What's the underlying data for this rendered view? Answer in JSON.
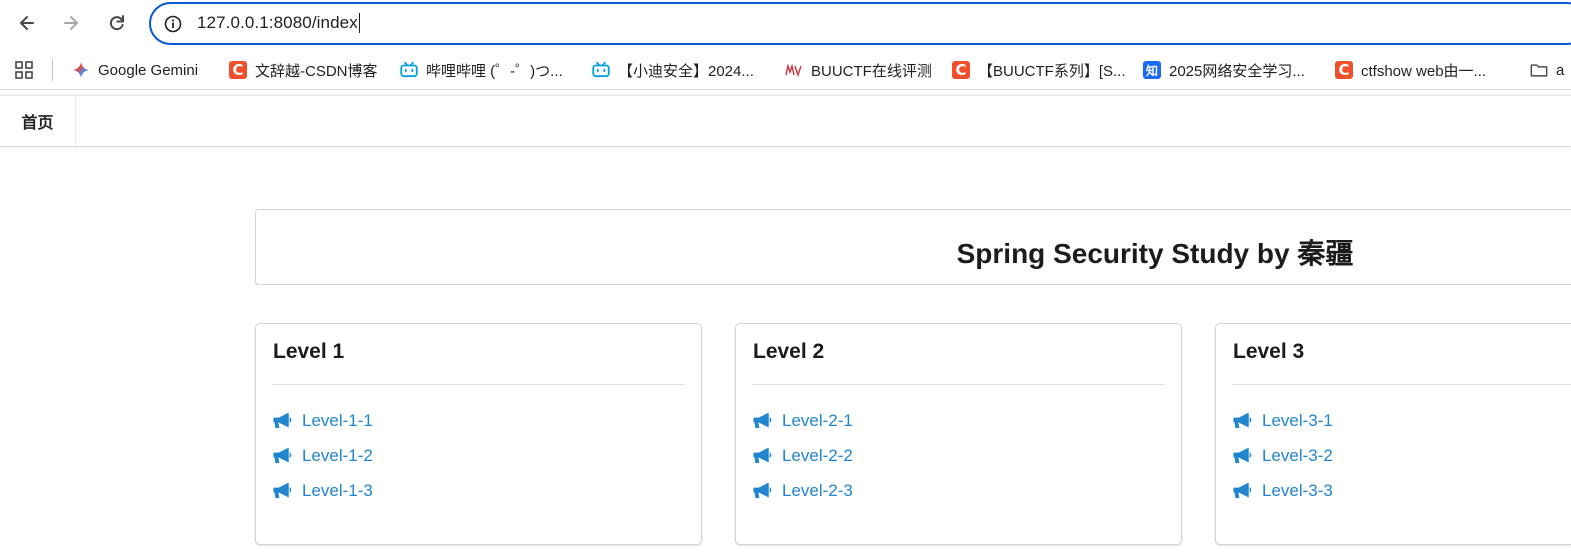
{
  "browser": {
    "url": "127.0.0.1:8080/index",
    "bookmarks": [
      {
        "label": "Google Gemini",
        "icon": "gemini-icon"
      },
      {
        "label": "文辞越-CSDN博客",
        "icon": "csdn-icon"
      },
      {
        "label": "哔哩哔哩 (゜-゜)つ...",
        "icon": "bilibili-icon"
      },
      {
        "label": "【小迪安全】2024...",
        "icon": "bilibili-icon"
      },
      {
        "label": "BUUCTF在线评测",
        "icon": "buuctf-icon"
      },
      {
        "label": "【BUUCTF系列】[S...",
        "icon": "csdn-icon"
      },
      {
        "label": "2025网络安全学习...",
        "icon": "zhihu-icon"
      },
      {
        "label": "ctfshow web由一...",
        "icon": "csdn-icon"
      },
      {
        "label": "a",
        "icon": "folder-icon"
      }
    ],
    "favicon_letters": {
      "csdn": "C",
      "zhihu": "知"
    }
  },
  "page": {
    "nav_home": "首页",
    "title": "Spring Security Study by 秦疆",
    "levels": [
      {
        "title": "Level 1",
        "links": [
          "Level-1-1",
          "Level-1-2",
          "Level-1-3"
        ]
      },
      {
        "title": "Level 2",
        "links": [
          "Level-2-1",
          "Level-2-2",
          "Level-2-3"
        ]
      },
      {
        "title": "Level 3",
        "links": [
          "Level-3-1",
          "Level-3-2",
          "Level-3-3"
        ]
      }
    ]
  },
  "colors": {
    "link": "#2185d0",
    "omnibox_border": "#0b57d0",
    "csdn": "#f04f2c",
    "zhihu": "#1a6af5",
    "bilibili": "#00a1d6"
  }
}
